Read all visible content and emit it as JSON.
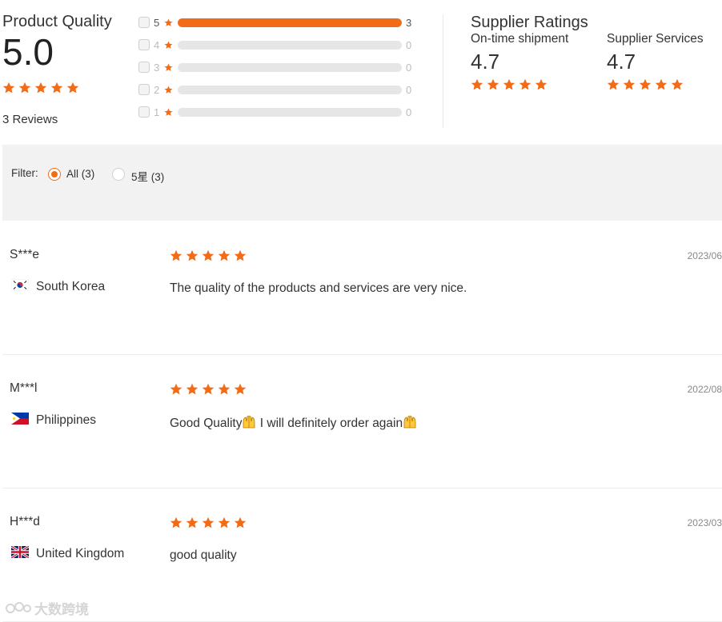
{
  "product_quality": {
    "title": "Product Quality",
    "score": "5.0",
    "stars": 5,
    "reviews_label": "3 Reviews",
    "breakdown": [
      {
        "level": "5",
        "count": "3",
        "fraction": 1.0
      },
      {
        "level": "4",
        "count": "0",
        "fraction": 0
      },
      {
        "level": "3",
        "count": "0",
        "fraction": 0
      },
      {
        "level": "2",
        "count": "0",
        "fraction": 0
      },
      {
        "level": "1",
        "count": "0",
        "fraction": 0
      }
    ]
  },
  "supplier_ratings": {
    "title": "Supplier Ratings",
    "items": [
      {
        "label": "On-time shipment",
        "value": "4.7",
        "stars": 5
      },
      {
        "label": "Supplier Services",
        "value": "4.7",
        "stars": 5
      }
    ]
  },
  "filter": {
    "label": "Filter:",
    "options": [
      {
        "label": "All (3)",
        "selected": true
      },
      {
        "label": "5星 (3)",
        "selected": false
      }
    ]
  },
  "reviews": [
    {
      "name": "S***e",
      "country": "South Korea",
      "flag": "flag-south-korea",
      "stars": 5,
      "date": "2023/06",
      "text": "The quality of the products and services are very nice."
    },
    {
      "name": "M***l",
      "country": "Philippines",
      "flag": "flag-philippines",
      "stars": 5,
      "date": "2022/08",
      "text_parts": [
        "Good Quality",
        " I will definitely order again"
      ],
      "emoji": "raising-hands-emoji"
    },
    {
      "name": "H***d",
      "country": "United Kingdom",
      "flag": "flag-united-kingdom",
      "stars": 5,
      "date": "2023/03",
      "text": "good quality"
    }
  ],
  "watermark": {
    "text": "大数跨境"
  },
  "colors": {
    "accent": "#f26c18",
    "track": "#e6e6e6",
    "filter_bg": "#f2f2f2"
  }
}
